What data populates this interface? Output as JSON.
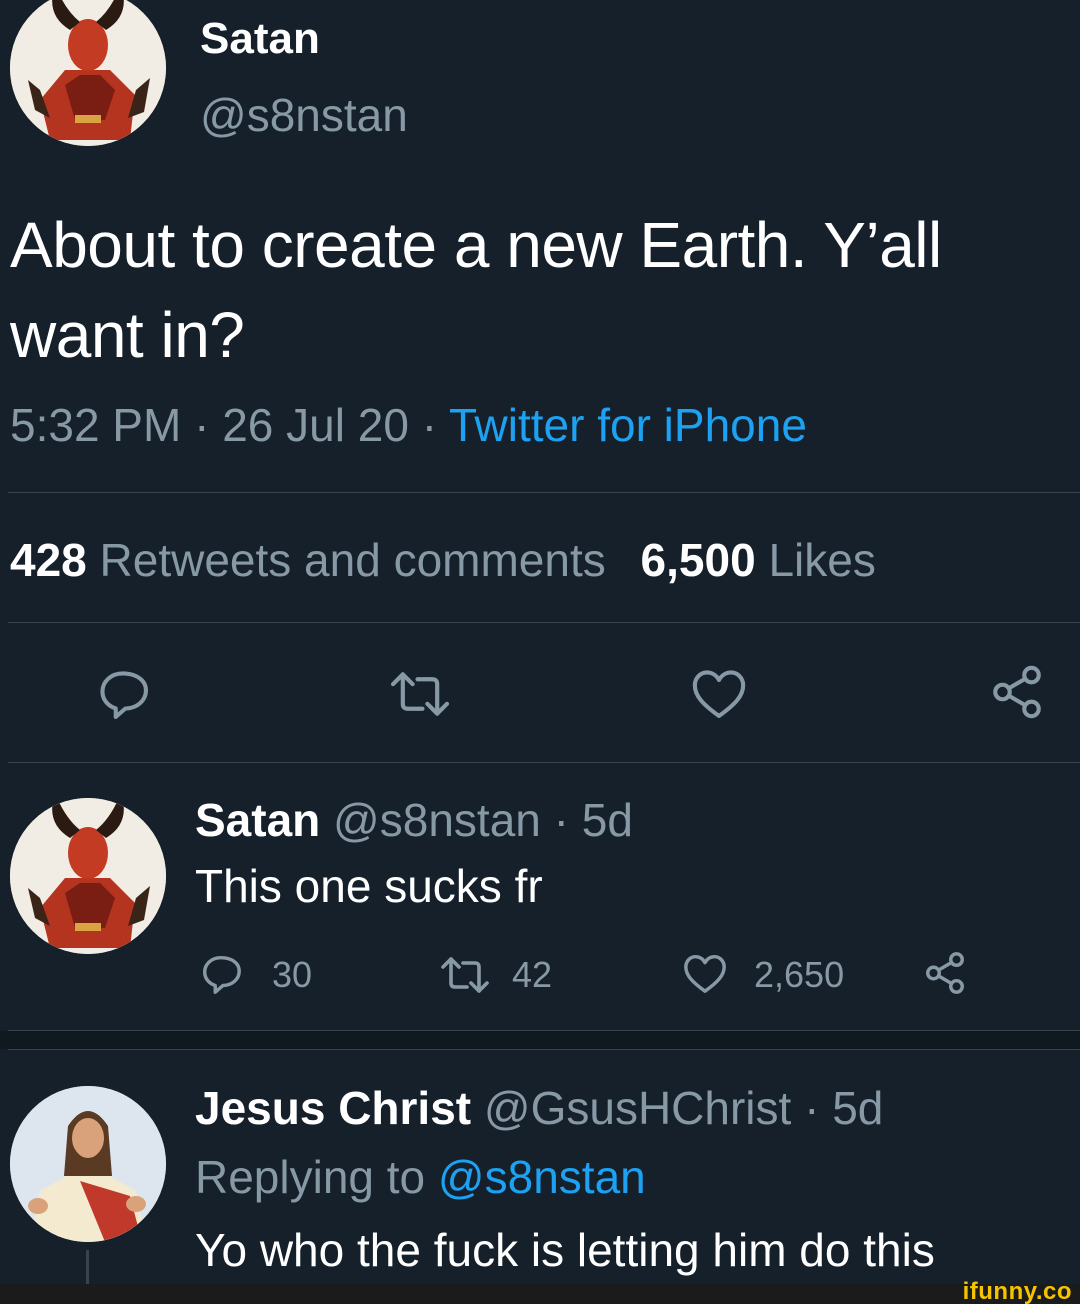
{
  "main_tweet": {
    "author_name": "Satan",
    "author_handle": "@s8nstan",
    "text": "About to create a new Earth. Y’all want in?",
    "time": "5:32 PM",
    "separator": "·",
    "date": "26 Jul 20",
    "source": "Twitter for iPhone",
    "stats": {
      "retweets_count": "428",
      "retweets_label": "Retweets and comments",
      "likes_count": "6,500",
      "likes_label": "Likes"
    },
    "actions": [
      "reply-icon",
      "retweet-icon",
      "like-icon",
      "share-icon"
    ]
  },
  "replies": [
    {
      "author_name": "Satan",
      "author_handle": "@s8nstan",
      "age": "· 5d",
      "text": "This one sucks fr",
      "reply_count": "30",
      "retweet_count": "42",
      "like_count": "2,650"
    },
    {
      "author_name": "Jesus Christ",
      "author_handle": "@GsusHChrist",
      "age": "· 5d",
      "replying_label": "Replying to",
      "replying_handle": "@s8nstan",
      "text": "Yo who the fuck is letting him do this"
    }
  ],
  "watermark": "ifunny.co",
  "colors": {
    "background": "#15202b",
    "text": "#ffffff",
    "muted": "#8899a6",
    "accent": "#1da1f2",
    "divider": "#38444d",
    "watermark_bar": "#1b1b1b",
    "watermark_text": "#f5c400"
  }
}
